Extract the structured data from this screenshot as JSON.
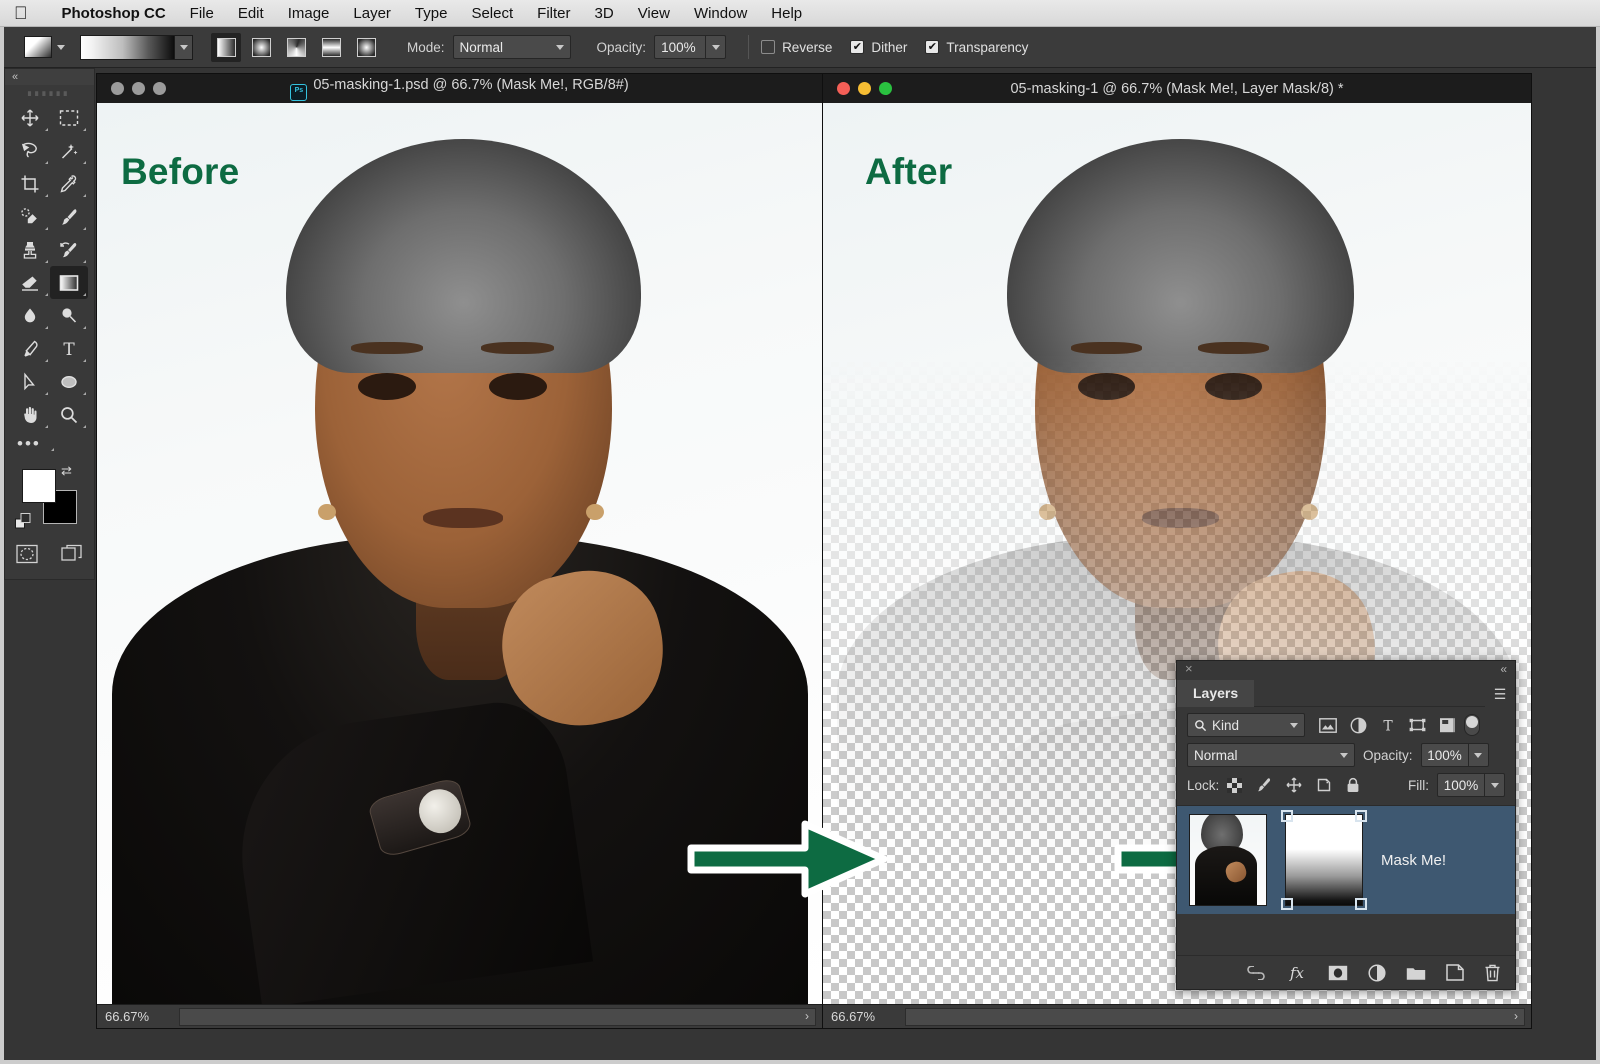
{
  "menubar": {
    "apple_icon": "apple-logo-icon",
    "items": [
      {
        "label": "Photoshop CC",
        "bold": true
      },
      {
        "label": "File"
      },
      {
        "label": "Edit"
      },
      {
        "label": "Image"
      },
      {
        "label": "Layer"
      },
      {
        "label": "Type"
      },
      {
        "label": "Select"
      },
      {
        "label": "Filter"
      },
      {
        "label": "3D"
      },
      {
        "label": "View"
      },
      {
        "label": "Window"
      },
      {
        "label": "Help"
      }
    ]
  },
  "options_bar": {
    "tool": "gradient-tool",
    "gradient_types": [
      "linear",
      "radial",
      "angle",
      "reflected",
      "diamond"
    ],
    "gradient_type_selected": "linear",
    "mode_label": "Mode:",
    "mode_value": "Normal",
    "opacity_label": "Opacity:",
    "opacity_value": "100%",
    "checkboxes": [
      {
        "label": "Reverse",
        "checked": false
      },
      {
        "label": "Dither",
        "checked": true
      },
      {
        "label": "Transparency",
        "checked": true
      }
    ]
  },
  "tools_panel": {
    "collapse_label": "«",
    "more_label": "•••",
    "tools": [
      {
        "name": "move-tool"
      },
      {
        "name": "rectangular-marquee-tool"
      },
      {
        "name": "lasso-tool"
      },
      {
        "name": "magic-wand-tool"
      },
      {
        "name": "crop-tool"
      },
      {
        "name": "eyedropper-tool"
      },
      {
        "name": "spot-healing-brush-tool"
      },
      {
        "name": "brush-tool"
      },
      {
        "name": "clone-stamp-tool"
      },
      {
        "name": "history-brush-tool"
      },
      {
        "name": "eraser-tool"
      },
      {
        "name": "gradient-tool"
      },
      {
        "name": "blur-tool"
      },
      {
        "name": "dodge-tool"
      },
      {
        "name": "pen-tool"
      },
      {
        "name": "type-tool"
      },
      {
        "name": "path-selection-tool"
      },
      {
        "name": "ellipse-tool"
      },
      {
        "name": "hand-tool"
      },
      {
        "name": "zoom-tool"
      }
    ],
    "selected_tool": "gradient-tool",
    "foreground_color": "#ffffff",
    "background_color": "#000000",
    "quick_mask_label": "quick-mask-mode",
    "screen_mode_label": "screen-mode"
  },
  "documents": [
    {
      "id": "before",
      "title": "05-masking-1.psd @ 66.7% (Mask Me!, RGB/8#)",
      "has_ps_badge": true,
      "active": false,
      "traffic_lights": "gray",
      "overlay_label": "Before",
      "zoom": "66.67%",
      "transparent": false
    },
    {
      "id": "after",
      "title": "05-masking-1 @ 66.7% (Mask Me!, Layer Mask/8) *",
      "has_ps_badge": false,
      "active": true,
      "traffic_lights": "color",
      "overlay_label": "After",
      "zoom": "66.67%",
      "transparent": true
    }
  ],
  "annotation": {
    "arrow_color": "#0d6b42",
    "arrow_outline": "#ffffff",
    "label_color": "#0d6b42"
  },
  "layers_panel": {
    "close_icon": "×",
    "collapse_icon": "«",
    "tab_label": "Layers",
    "menu_icon": "panel-menu-icon",
    "filter_label": "Kind",
    "filter_icons": [
      "pixel-layers-filter-icon",
      "adjustment-layers-filter-icon",
      "type-layers-filter-icon",
      "shape-layers-filter-icon",
      "smart-object-filter-icon"
    ],
    "filter_toggle": "filter-enable-toggle",
    "blend_mode": "Normal",
    "opacity_label": "Opacity:",
    "opacity_value": "100%",
    "lock_label": "Lock:",
    "lock_icons": [
      "lock-transparent-pixels-icon",
      "lock-image-pixels-icon",
      "lock-position-icon",
      "lock-artboard-nesting-icon",
      "lock-all-icon"
    ],
    "fill_label": "Fill:",
    "fill_value": "100%",
    "layers": [
      {
        "name": "Mask Me!",
        "selected": true,
        "has_mask": true,
        "mask_selected": true,
        "mask_type": "gradient white to black"
      }
    ],
    "bottom_icons": [
      "link-layers-icon",
      "layer-style-fx-icon",
      "add-layer-mask-icon",
      "new-adjustment-layer-icon",
      "new-group-icon",
      "new-layer-icon",
      "delete-layer-icon"
    ],
    "fx_label": "fx"
  }
}
